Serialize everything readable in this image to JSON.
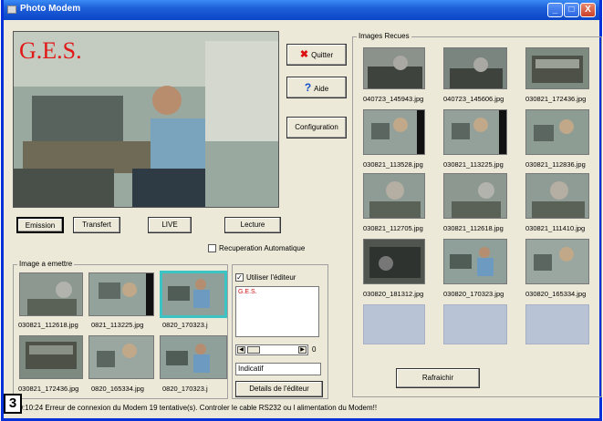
{
  "window": {
    "title": "Photo Modem"
  },
  "titlebar": {
    "minimize": "_",
    "maximize": "□",
    "close": "X"
  },
  "preview": {
    "overlay_text": "G.E.S."
  },
  "buttons": {
    "quitter": "Quitter",
    "aide": "Aide",
    "configuration": "Configuration",
    "emission": "Emission",
    "transfert": "Transfert",
    "live": "LIVE",
    "lecture": "Lecture",
    "rafraichir": "Rafraichir",
    "details": "Details de l'éditeur"
  },
  "auto_recovery": {
    "label": "Recuperation Automatique",
    "checked": false
  },
  "image_emit": {
    "label": "Image a emettre",
    "captions_row1": [
      "030821_112618.jpg",
      "0821_113225.jpg",
      "0820_170323.j"
    ],
    "captions_row2": [
      "030821_172436.jpg",
      "0820_165334.jpg",
      "0820_170323.j"
    ]
  },
  "editor": {
    "use_label": "Utiliser l'éditeur",
    "use_checked": true,
    "text": "G.E.S.",
    "slider_value": "0",
    "indicatif": "Indicatif"
  },
  "received": {
    "label": "Images Recues",
    "captions": [
      "040723_145943.jpg",
      "040723_145606.jpg",
      "030821_172436.jpg",
      "030821_113528.jpg",
      "030821_113225.jpg",
      "030821_112836.jpg",
      "030821_112705.jpg",
      "030821_112618.jpg",
      "030821_111410.jpg",
      "030820_181312.jpg",
      "030820_170323.jpg",
      "030820_165334.jpg"
    ]
  },
  "status": {
    "text": "10:10:24  Erreur de connexion du Modem 19 tentative(s). Controler le cable RS232 ou l alimentation du Modem!!"
  },
  "figure_badge": "3"
}
